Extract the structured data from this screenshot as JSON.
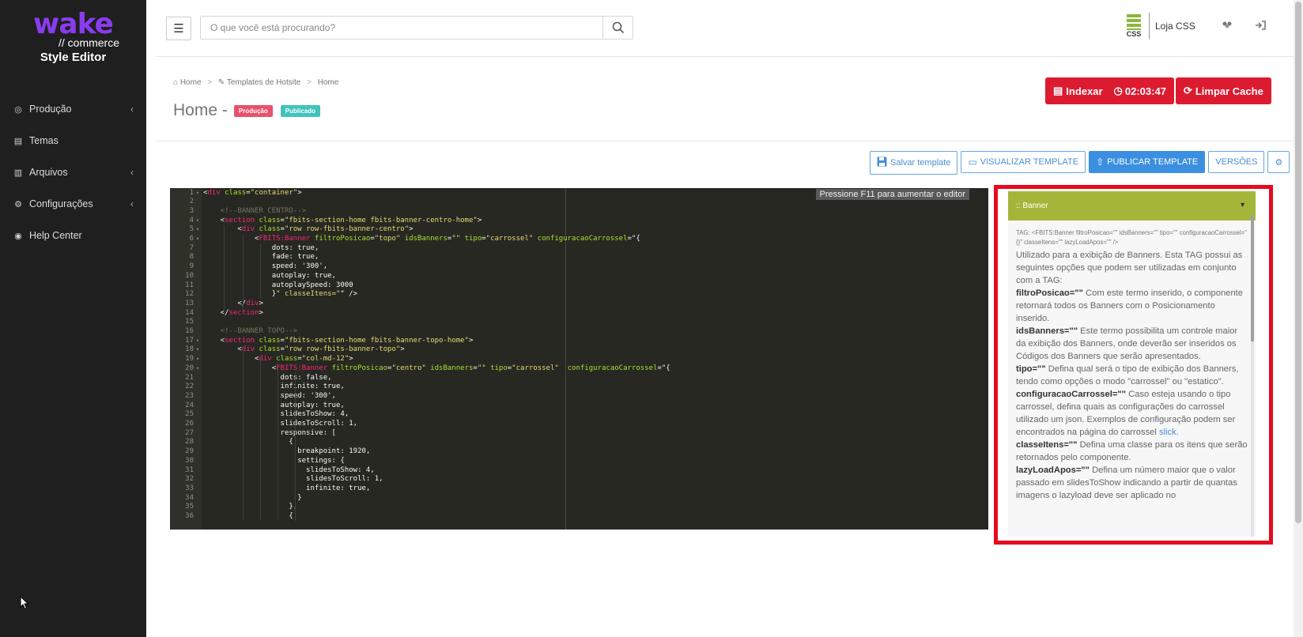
{
  "sidebar": {
    "logo_wake": "wake",
    "logo_commerce": "// commerce",
    "title": "Style Editor",
    "items": [
      {
        "label": "Produção",
        "icon": "globe-icon",
        "has_chevron": true
      },
      {
        "label": "Temas",
        "icon": "files-icon",
        "has_chevron": false
      },
      {
        "label": "Arquivos",
        "icon": "file-icon",
        "has_chevron": true
      },
      {
        "label": "Configurações",
        "icon": "gears-icon",
        "has_chevron": true
      },
      {
        "label": "Help Center",
        "icon": "lifebuoy-icon",
        "has_chevron": false
      }
    ]
  },
  "header": {
    "search_placeholder": "O que você está procurando?",
    "store_logo_text": "CSS",
    "store_name": "Loja CSS"
  },
  "breadcrumb": [
    "Home",
    "Templates de Hotsite",
    "Home"
  ],
  "page": {
    "title": "Home -",
    "badge_production": "Produção",
    "badge_published": "Publicado"
  },
  "actions": {
    "index_label": "Indexar",
    "timer": "02:03:47",
    "clear_cache_label": "Limpar Cache"
  },
  "toolbar": {
    "save": "Salvar template",
    "view": "VISUALIZAR TEMPLATE",
    "publish": "PUBLICAR TEMPLATE",
    "versions": "VERSÕES"
  },
  "editor": {
    "hint": "Pressione F11 para aumentar o editor",
    "lines": [
      "<div class=\"container\">",
      "",
      "    <!--BANNER CENTRO-->",
      "    <section class=\"fbits-section-home fbits-banner-centro-home\">",
      "        <div class=\"row row-fbits-banner-centro\">",
      "            <FBITS:Banner filtroPosicao=\"topo\" idsBanners=\"\" tipo=\"carrossel\" configuracaoCarrossel=\"{",
      "                dots: true,",
      "                fade: true,",
      "                speed: '300',",
      "                autoplay: true,",
      "                autoplaySpeed: 3000",
      "                }\" classeItens=\"\" />",
      "        </div>",
      "    </section>",
      "",
      "    <!--BANNER TOPO-->",
      "    <section class=\"fbits-section-home fbits-banner-topo-home\">",
      "        <div class=\"row row-fbits-banner-topo\">",
      "            <div class=\"col-md-12\">",
      "                <FBITS:Banner filtroPosicao=\"centro\" idsBanners=\"\" tipo=\"carrossel\"  configuracaoCarrossel=\"{",
      "                  dots: false,",
      "                  infinite: true,",
      "                  speed: '300',",
      "                  autoplay: true,",
      "                  slidesToShow: 4,",
      "                  slidesToScroll: 1,",
      "                  responsive: [",
      "                    {",
      "                      breakpoint: 1920,",
      "                      settings: {",
      "                        slidesToShow: 4,",
      "                        slidesToScroll: 1,",
      "                        infinite: true,",
      "                      }",
      "                    },",
      "                    {"
    ],
    "fold_lines": [
      1,
      4,
      5,
      6,
      17,
      18,
      19,
      20
    ]
  },
  "panel": {
    "header": ":: Banner",
    "tag": "TAG: <FBITS:Banner filtroPosicao=\"\" idsBanners=\"\" tipo=\"\" configuracaoCarrossel=\"{}\" classeItens=\"\" lazyLoadApos=\"\" />",
    "intro": "Utilizado para a exibição de Banners. Esta TAG possui as seguintes opções que podem ser utilizadas em conjunto com a TAG:",
    "params": [
      {
        "name": "filtroPosicao=\"\"",
        "desc": " Com este termo inserido, o componente retornará todos os Banners com o Posicionamento inserido."
      },
      {
        "name": "idsBanners=\"\"",
        "desc": " Este termo possibilita um controle maior da exibição dos Banners, onde deverão ser inseridos os Códigos dos Banners que serão apresentados."
      },
      {
        "name": "tipo=\"\"",
        "desc": " Defina qual será o tipo de exibição dos Banners, tendo como opções o modo \"carrossel\" ou \"estatico\"."
      },
      {
        "name": "configuracaoCarrossel=\"\"",
        "desc": " Caso esteja usando o tipo carrossel, defina quais as configurações do carrossel utilizado um json. Exemplos de configuração podem ser encontrados na página do carrossel ",
        "link": "slick",
        "tail": "."
      },
      {
        "name": "classeItens=\"\"",
        "desc": " Defina uma classe para os itens que serão retornados pelo componente."
      },
      {
        "name": "lazyLoadApos=\"\"",
        "desc": " Defina um número maior que o valor passado em slidesToShow indicando a partir de quantas imagens o lazyload deve ser aplicado no"
      }
    ]
  }
}
